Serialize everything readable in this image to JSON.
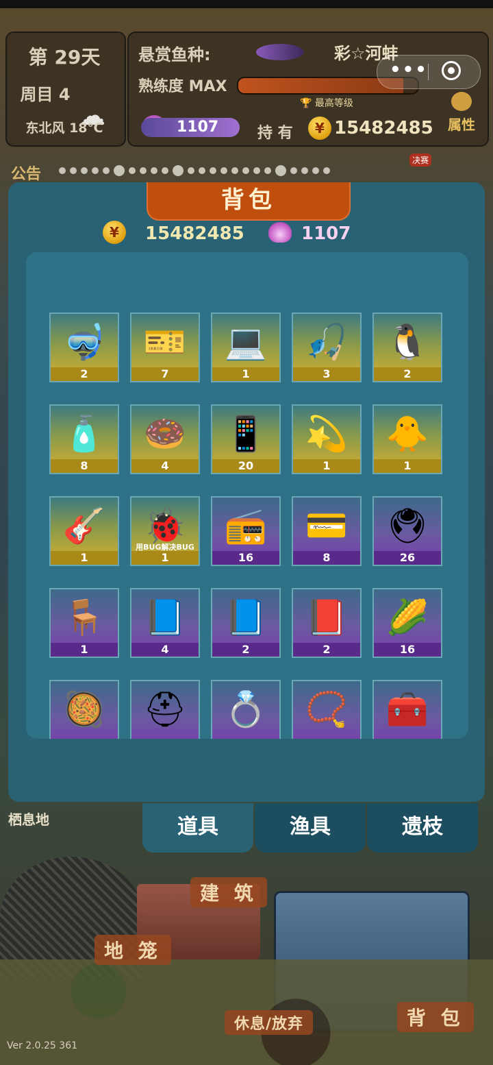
{
  "status": {
    "day": "第 29天",
    "week": "周目 4",
    "wind": "东北风 18℃",
    "weather_icon": "rain-cloud-icon"
  },
  "bounty": {
    "label": "悬赏鱼种:",
    "fish_name": "彩☆河蚌",
    "mastery_label": "熟练度 MAX",
    "mastery_fraction": 0.92,
    "max_level": "最高等级",
    "pearls": "1107",
    "own_label": "持 有",
    "coins": "15482485",
    "attr_label": "属性"
  },
  "notice": {
    "label": "公告",
    "final_tag": "决赛"
  },
  "bag": {
    "title": "背包",
    "coins": "15482485",
    "pearls": "1107",
    "items": [
      {
        "glyph": "🤿",
        "count": "2",
        "tier": "gold",
        "name": "snorkel-mask-item"
      },
      {
        "glyph": "🎫",
        "count": "7",
        "tier": "gold",
        "name": "vip-card-item"
      },
      {
        "glyph": "💻",
        "count": "1",
        "tier": "gold",
        "name": "laptop-item"
      },
      {
        "glyph": "🎣",
        "count": "3",
        "tier": "gold",
        "name": "fishing-rod-item"
      },
      {
        "glyph": "🐧",
        "count": "2",
        "tier": "gold",
        "name": "penguin-figure-item"
      },
      {
        "glyph": "🧴",
        "count": "8",
        "tier": "gold",
        "name": "spray-can-item"
      },
      {
        "glyph": "🍩",
        "count": "4",
        "tier": "gold",
        "name": "ring-float-item"
      },
      {
        "glyph": "📱",
        "count": "20",
        "tier": "gold",
        "name": "video-phone-item"
      },
      {
        "glyph": "💫",
        "count": "1",
        "tier": "gold",
        "name": "sparkle-ring-item"
      },
      {
        "glyph": "🐥",
        "count": "1",
        "tier": "gold",
        "name": "chick-item"
      },
      {
        "glyph": "🎸",
        "count": "1",
        "tier": "gold",
        "name": "ukulele-item"
      },
      {
        "glyph": "🐞",
        "count": "1",
        "tier": "gold",
        "name": "bug-fix-item",
        "caption": "用BUG解决BUG"
      },
      {
        "glyph": "📻",
        "count": "16",
        "tier": "purple",
        "name": "radio-item"
      },
      {
        "glyph": "💳",
        "count": "8",
        "tier": "purple",
        "name": "black-card-item"
      },
      {
        "glyph": "🖲",
        "count": "26",
        "tier": "purple",
        "name": "fingerprint-machine-item"
      },
      {
        "glyph": "🪑",
        "count": "1",
        "tier": "purple",
        "name": "golden-chair-item"
      },
      {
        "glyph": "📘",
        "count": "4",
        "tier": "purple",
        "name": "guide-book-item-1"
      },
      {
        "glyph": "📘",
        "count": "2",
        "tier": "purple",
        "name": "guide-book-item-2"
      },
      {
        "glyph": "📕",
        "count": "2",
        "tier": "purple",
        "name": "guide-book-item-3"
      },
      {
        "glyph": "🌽",
        "count": "16",
        "tier": "purple",
        "name": "corn-item"
      },
      {
        "glyph": "🥘",
        "count": "",
        "tier": "purple",
        "name": "bait-plate-item"
      },
      {
        "glyph": "⛑",
        "count": "",
        "tier": "purple",
        "name": "helmet-item"
      },
      {
        "glyph": "💍",
        "count": "",
        "tier": "purple",
        "name": "ring-item"
      },
      {
        "glyph": "📿",
        "count": "",
        "tier": "purple",
        "name": "necklace-item"
      },
      {
        "glyph": "🧰",
        "count": "",
        "tier": "purple",
        "name": "treasure-box-item"
      }
    ],
    "tabs": [
      "道具",
      "渔具",
      "遗枝"
    ]
  },
  "scene": {
    "habitat": "栖息地",
    "build": "建 筑",
    "cage": "地 笼",
    "rest": "休息/放弃",
    "bag_button": "背 包",
    "version": "Ver 2.0.25 361"
  },
  "colors": {
    "modal": "#286274",
    "title": "#c04e0c",
    "gold_tier": "#d8b030",
    "purple_tier": "#7a3ab0"
  }
}
